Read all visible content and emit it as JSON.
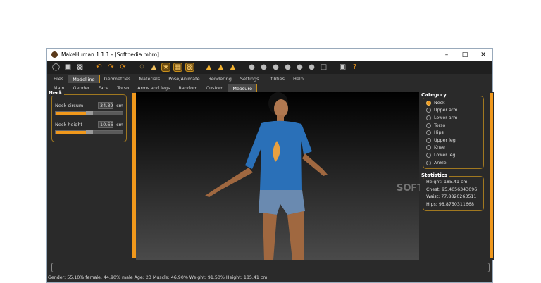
{
  "window": {
    "title": "MakeHuman 1.1.1 - [Softpedia.mhm]"
  },
  "toolbar": {
    "icons": [
      "new-icon",
      "save-icon",
      "export-icon",
      "undo-icon",
      "redo-icon",
      "reset-icon",
      "smooth-icon",
      "wireframe-icon",
      "pose-icon",
      "grid-icon",
      "checker-icon",
      "symmetry-right-icon",
      "symmetry-left-icon",
      "symmetry-icon",
      "front-view-icon",
      "back-view-icon",
      "left-view-icon",
      "right-view-icon",
      "top-view-icon",
      "bottom-view-icon",
      "reset-camera-icon",
      "screenshot-icon",
      "help-icon"
    ]
  },
  "main_tabs": [
    "Files",
    "Modelling",
    "Geometries",
    "Materials",
    "Pose/Animate",
    "Rendering",
    "Settings",
    "Utilities",
    "Help"
  ],
  "sub_tabs": [
    "Main",
    "Gender",
    "Face",
    "Torso",
    "Arms and legs",
    "Random",
    "Custom",
    "Measure"
  ],
  "left": {
    "group": "Neck",
    "sliders": [
      {
        "label": "Neck circum",
        "value": "34.89",
        "unit": "cm",
        "fill": 0.45
      },
      {
        "label": "Neck height",
        "value": "10.66",
        "unit": "cm",
        "fill": 0.45
      }
    ]
  },
  "right": {
    "category_title": "Category",
    "categories": [
      "Neck",
      "Upper arm",
      "Lower arm",
      "Torso",
      "Hips",
      "Upper leg",
      "Knee",
      "Lower leg",
      "Ankle"
    ],
    "selected": "Neck",
    "statistics_title": "Statistics",
    "stats": [
      "Height: 185.41 cm",
      "Chest: 95.4056343096",
      "Waist: 77.8820263511",
      "Hips: 98.8750311668"
    ]
  },
  "viewport": {
    "watermark": "SOFTPEDIA"
  },
  "status": "Gender: 55.10% female, 44.90% male Age: 23 Muscle: 46.90% Weight: 91.50% Height: 185.41 cm",
  "colors": {
    "accent": "#f0981c",
    "background": "#2a2a2a"
  }
}
